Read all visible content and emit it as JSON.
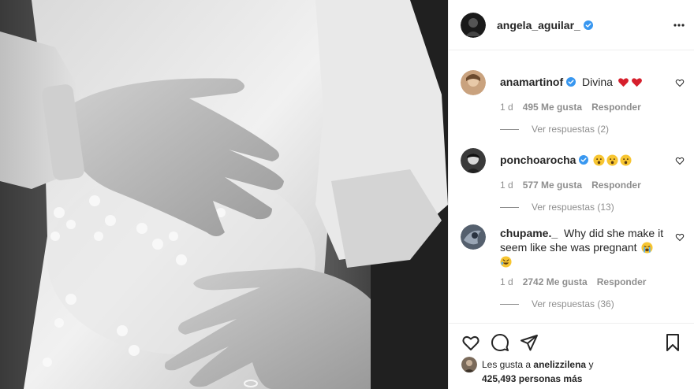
{
  "post": {
    "author": "angela_aguilar_"
  },
  "comments": [
    {
      "username": "anamartinof",
      "text": "Divina",
      "emoji": [
        "red-heart",
        "red-heart"
      ],
      "time": "1 d",
      "likes": "495 Me gusta",
      "reply_label": "Responder",
      "view_replies": "Ver respuestas (2)"
    },
    {
      "username": "ponchoarocha",
      "text": "",
      "emoji": [
        "astonished-face",
        "astonished-face",
        "astonished-face"
      ],
      "time": "1 d",
      "likes": "577 Me gusta",
      "reply_label": "Responder",
      "view_replies": "Ver respuestas (13)"
    },
    {
      "username": "chupame._",
      "text": "Why did she make it seem like she was pregnant",
      "emoji": [
        "loudly-crying-face",
        "rolling-laughing-face"
      ],
      "time": "1 d",
      "likes": "2742 Me gusta",
      "reply_label": "Responder",
      "view_replies": "Ver respuestas (36)"
    }
  ],
  "likes_bar": {
    "prefix": "Les gusta a",
    "liker": "anelizzilena",
    "connector": "y",
    "count": "425,493",
    "suffix": "personas más"
  },
  "icons": {
    "more": "more-horizontal-icon",
    "like": "heart-icon",
    "comment": "comment-icon",
    "share": "share-icon",
    "save": "bookmark-icon",
    "verified": "verified-badge-icon"
  },
  "colors": {
    "verified": "#3897f0",
    "meta_gray": "#8e8e8e",
    "text": "#262626",
    "heart_red": "#d61f2c"
  }
}
